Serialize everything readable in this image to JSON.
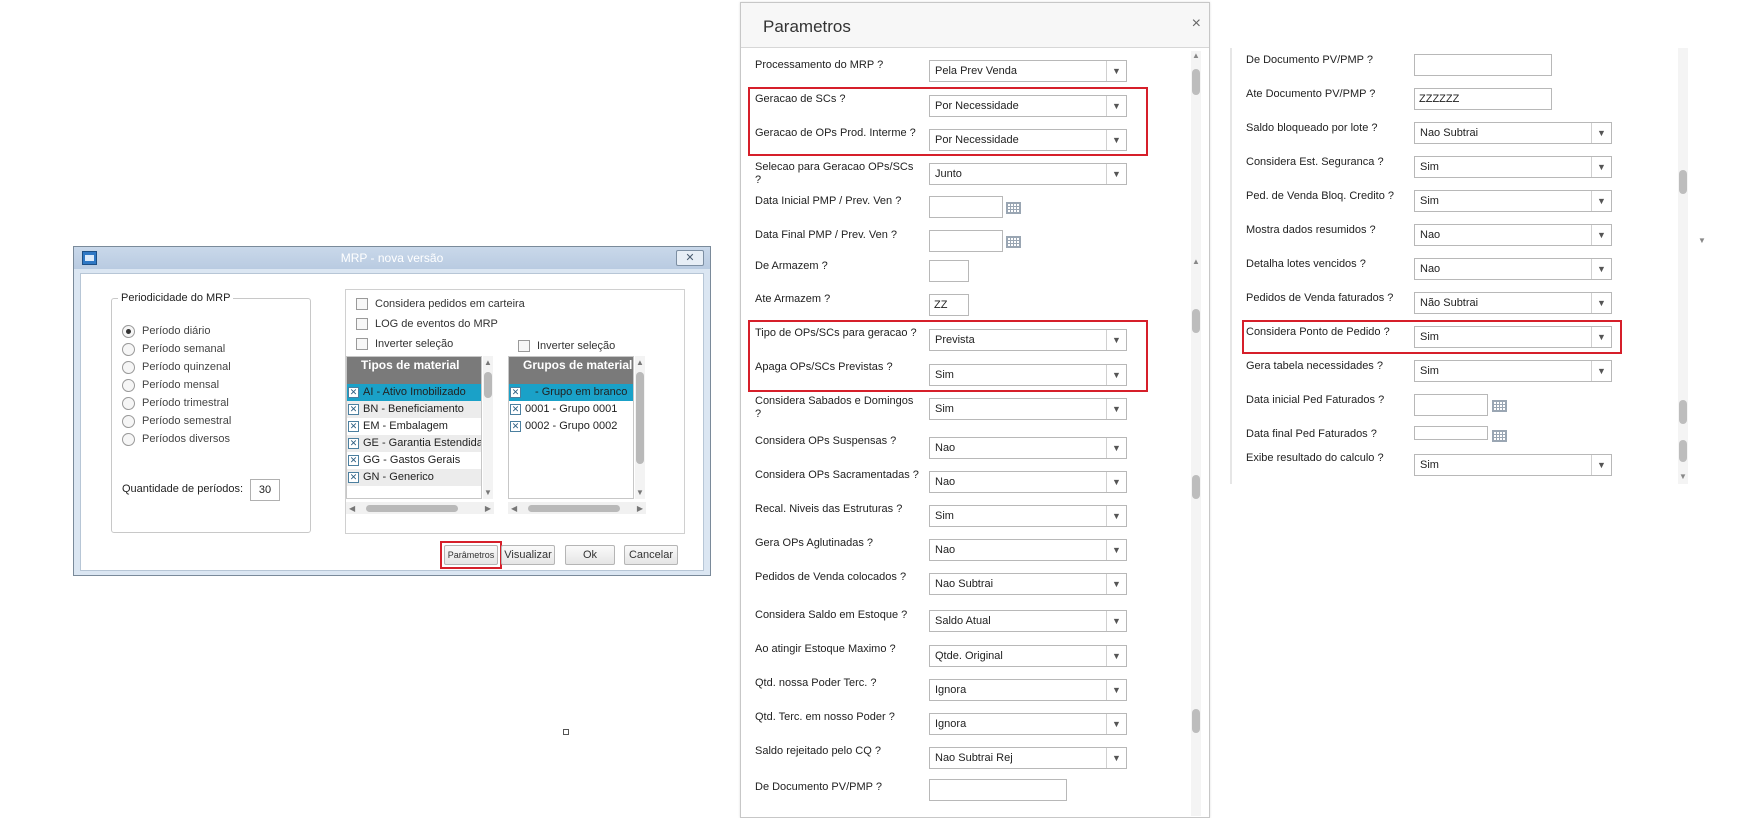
{
  "mrp": {
    "title": "MRP - nova versão",
    "period_group_title": "Periodicidade do MRP",
    "periods": [
      {
        "label": "Período diário",
        "checked": true
      },
      {
        "label": "Período semanal",
        "checked": false
      },
      {
        "label": "Período quinzenal",
        "checked": false
      },
      {
        "label": "Período mensal",
        "checked": false
      },
      {
        "label": "Período trimestral",
        "checked": false
      },
      {
        "label": "Período semestral",
        "checked": false
      },
      {
        "label": "Períodos diversos",
        "checked": false
      }
    ],
    "qtd_label": "Quantidade de períodos:",
    "qtd_value": "30",
    "chk_carteira": "Considera pedidos em carteira",
    "chk_log": "LOG de eventos do MRP",
    "inverter_label": "Inverter seleção",
    "tipos_header": "Tipos de material",
    "tipos": [
      "AI - Ativo Imobilizado",
      "BN - Beneficiamento",
      "EM - Embalagem",
      "GE - Garantia Estendida",
      "GG - Gastos Gerais",
      "GN - Generico"
    ],
    "grupos_header": "Grupos de material",
    "grupos": [
      "- Grupo em branco",
      "0001 - Grupo 0001",
      "0002 - Grupo 0002"
    ],
    "buttons": {
      "parametros": "Parâmetros",
      "visualizar": "Visualizar",
      "ok": "Ok",
      "cancelar": "Cancelar"
    }
  },
  "parametros": {
    "title": "Parametros",
    "close": "×",
    "left_fields": [
      {
        "label": "Processamento do MRP ?",
        "value": "Pela Prev Venda"
      },
      {
        "label": "Geracao de SCs ?",
        "value": "Por Necessidade"
      },
      {
        "label": "Geracao de OPs Prod. Interme ?",
        "value": "Por Necessidade"
      },
      {
        "label": "Selecao para Geracao OPs/SCs ?",
        "value": "Junto"
      },
      {
        "label": "Data Inicial PMP / Prev. Ven ?",
        "value": ""
      },
      {
        "label": "Data Final PMP / Prev. Ven ?",
        "value": ""
      },
      {
        "label": "De Armazem ?",
        "value": ""
      },
      {
        "label": "Ate Armazem ?",
        "value": "ZZ"
      },
      {
        "label": "Tipo de OPs/SCs para geracao ?",
        "value": "Prevista"
      },
      {
        "label": "Apaga OPs/SCs Previstas ?",
        "value": "Sim"
      },
      {
        "label": "Considera Sabados e Domingos ?",
        "value": "Sim"
      },
      {
        "label": "Considera OPs Suspensas ?",
        "value": "Nao"
      },
      {
        "label": "Considera OPs Sacramentadas ?",
        "value": "Nao"
      },
      {
        "label": "Recal. Niveis das Estruturas ?",
        "value": "Sim"
      },
      {
        "label": "Gera OPs Aglutinadas ?",
        "value": "Nao"
      },
      {
        "label": "Pedidos de Venda colocados ?",
        "value": "Nao Subtrai"
      },
      {
        "label": "Considera Saldo em Estoque ?",
        "value": "Saldo Atual"
      },
      {
        "label": "Ao atingir Estoque Maximo ?",
        "value": "Qtde. Original"
      },
      {
        "label": "Qtd. nossa Poder Terc. ?",
        "value": "Ignora"
      },
      {
        "label": "Qtd. Terc. em nosso Poder ?",
        "value": "Ignora"
      },
      {
        "label": "Saldo rejeitado pelo CQ ?",
        "value": "Nao Subtrai Rej"
      },
      {
        "label": "De  Documento PV/PMP ?",
        "value": ""
      }
    ],
    "right_fields": [
      {
        "label": "De  Documento PV/PMP ?",
        "value": ""
      },
      {
        "label": "Ate Documento PV/PMP ?",
        "value": "ZZZZZZ"
      },
      {
        "label": "Saldo bloqueado por lote ?",
        "value": "Nao Subtrai"
      },
      {
        "label": "Considera Est. Seguranca ?",
        "value": "Sim"
      },
      {
        "label": "Ped. de Venda Bloq. Credito ?",
        "value": "Sim"
      },
      {
        "label": "Mostra dados resumidos ?",
        "value": "Nao"
      },
      {
        "label": "Detalha lotes vencidos ?",
        "value": "Nao"
      },
      {
        "label": "Pedidos de Venda faturados ?",
        "value": "Não Subtrai"
      },
      {
        "label": "Considera Ponto de Pedido ?",
        "value": "Sim"
      },
      {
        "label": "Gera tabela necessidades ?",
        "value": "Sim"
      },
      {
        "label": "Data inicial Ped Faturados ?",
        "value": ""
      },
      {
        "label": "Data final Ped Faturados ?",
        "value": ""
      },
      {
        "label": "Exibe resultado do calculo ?",
        "value": "Sim"
      }
    ]
  }
}
